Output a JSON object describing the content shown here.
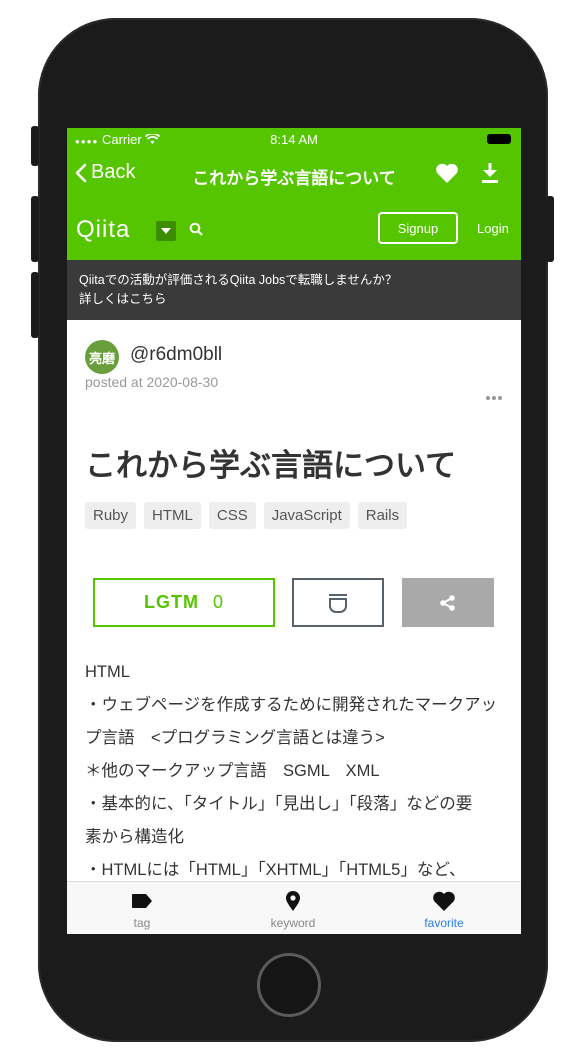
{
  "status_bar": {
    "carrier": "Carrier",
    "time": "8:14 AM"
  },
  "nav": {
    "back_label": "Back",
    "title": "これから学ぶ言語について"
  },
  "qiita_header": {
    "logo": "Qiita",
    "signup_label": "Signup",
    "login_label": "Login"
  },
  "banner": {
    "line1": "Qiitaでの活動が評価されるQiita Jobsで転職しませんか？",
    "line2": "詳しくはこちら"
  },
  "author": {
    "avatar_text": "亮磨",
    "username": "@r6dm0bll",
    "posted": "posted at 2020-08-30"
  },
  "article": {
    "title": "これから学ぶ言語について",
    "tags": [
      "Ruby",
      "HTML",
      "CSS",
      "JavaScript",
      "Rails"
    ],
    "lgtm_label": "LGTM",
    "lgtm_count": "0",
    "body": [
      "HTML",
      "・ウェブページを作成するために開発されたマークアッ",
      "プ言語　<プログラミング言語とは違う>",
      "＊他のマークアップ言語　SGML　XML",
      "・基本的に、「タイトル」「見出し」「段落」などの要",
      "素から構造化",
      "・HTMLには「HTML」「XHTML」「HTML5」など、"
    ]
  },
  "tabbar": [
    {
      "label": "tag",
      "icon": "tag-icon"
    },
    {
      "label": "keyword",
      "icon": "location-pin-icon"
    },
    {
      "label": "favorite",
      "icon": "heart-icon",
      "active": true
    }
  ],
  "colors": {
    "brand_green": "#55c500",
    "banner_bg": "#3a3a3a",
    "active_tab": "#2b7de9"
  }
}
